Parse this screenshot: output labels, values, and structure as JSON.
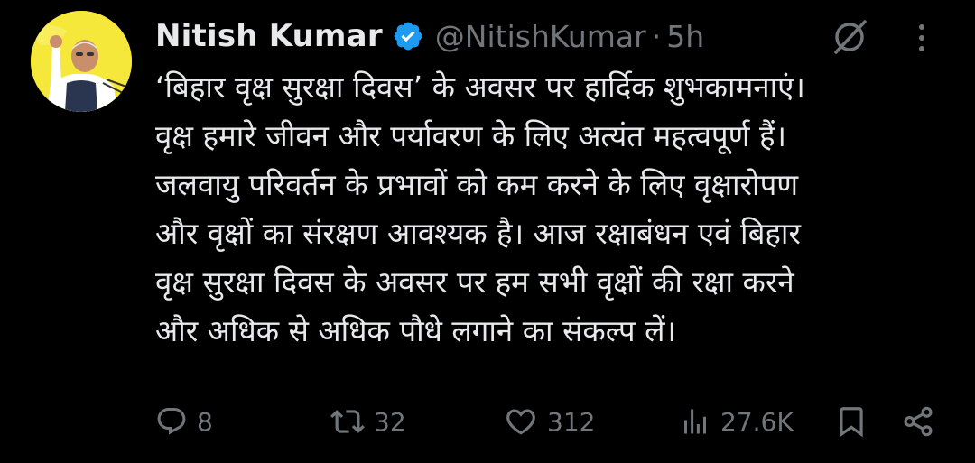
{
  "author": {
    "display_name": "Nitish Kumar",
    "handle": "@NitishKumar",
    "separator": "·",
    "time": "5h",
    "verified_color": "#1d9bf0"
  },
  "tweet": {
    "lines": [
      "‘बिहार वृक्ष सुरक्षा दिवस’ के अवसर पर हार्दिक शुभकामनाएं।",
      "वृक्ष हमारे जीवन और पर्यावरण के लिए अत्यंत महत्वपूर्ण हैं।",
      "जलवायु परिवर्तन के प्रभावों को कम करने के लिए वृक्षारोपण",
      "और वृक्षों का संरक्षण आवश्यक है। आज रक्षाबंधन एवं बिहार",
      "वृक्ष सुरक्षा दिवस के अवसर पर हम सभी वृक्षों की रक्षा करने",
      "और अधिक से अधिक पौधे लगाने का संकल्प लें।"
    ]
  },
  "actions": {
    "replies": "8",
    "reposts": "32",
    "likes": "312",
    "views": "27.6K"
  },
  "icons": {
    "grok": "grok-icon",
    "more": "more-dots-icon",
    "reply": "reply-icon",
    "repost": "repost-icon",
    "like": "heart-icon",
    "views": "views-chart-icon",
    "bookmark": "bookmark-icon",
    "share": "share-icon"
  },
  "colors": {
    "background": "#000000",
    "text": "#e7e9ea",
    "muted": "#71767b",
    "avatar_bg": "#f5e83a"
  }
}
